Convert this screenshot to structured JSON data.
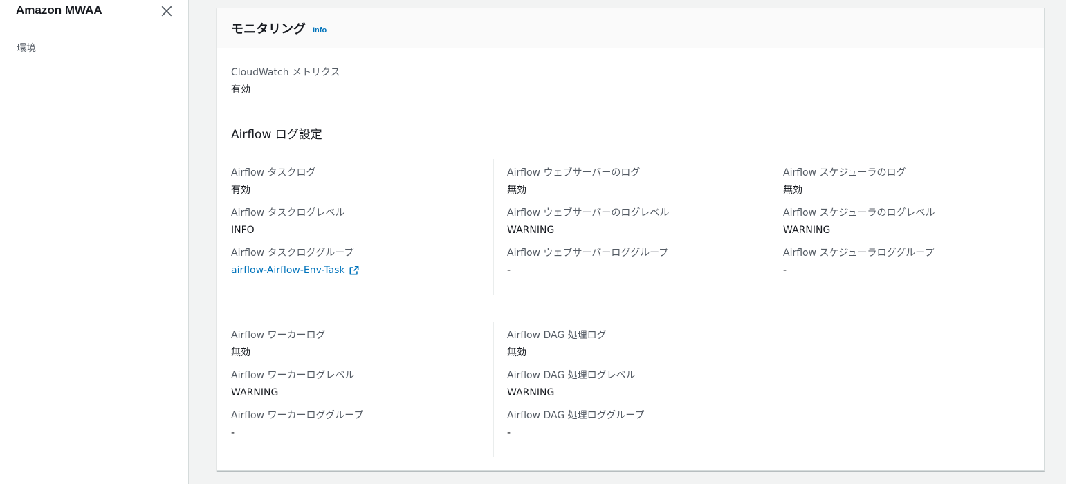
{
  "sidebar": {
    "title": "Amazon MWAA",
    "nav_items": [
      {
        "label": "環境"
      }
    ]
  },
  "panel": {
    "title": "モニタリング",
    "info_label": "Info",
    "cloudwatch": {
      "label": "CloudWatch メトリクス",
      "value": "有効"
    },
    "airflow_log_heading": "Airflow ログ設定",
    "groups_row1": [
      {
        "items": [
          {
            "label": "Airflow タスクログ",
            "value": "有効"
          },
          {
            "label": "Airflow タスクログレベル",
            "value": "INFO"
          },
          {
            "label": "Airflow タスクロググループ",
            "value": "airflow-Airflow-Env-Task",
            "is_link": true
          }
        ]
      },
      {
        "items": [
          {
            "label": "Airflow ウェブサーバーのログ",
            "value": "無効"
          },
          {
            "label": "Airflow ウェブサーバーのログレベル",
            "value": "WARNING"
          },
          {
            "label": "Airflow ウェブサーバーロググループ",
            "value": "-"
          }
        ]
      },
      {
        "items": [
          {
            "label": "Airflow スケジューラのログ",
            "value": "無効"
          },
          {
            "label": "Airflow スケジューラのログレベル",
            "value": "WARNING"
          },
          {
            "label": "Airflow スケジューラロググループ",
            "value": "-"
          }
        ]
      }
    ],
    "groups_row2": [
      {
        "items": [
          {
            "label": "Airflow ワーカーログ",
            "value": "無効"
          },
          {
            "label": "Airflow ワーカーログレベル",
            "value": "WARNING"
          },
          {
            "label": "Airflow ワーカーロググループ",
            "value": "-"
          }
        ]
      },
      {
        "items": [
          {
            "label": "Airflow DAG 処理ログ",
            "value": "無効"
          },
          {
            "label": "Airflow DAG 処理ログレベル",
            "value": "WARNING"
          },
          {
            "label": "Airflow DAG 処理ロググループ",
            "value": "-"
          }
        ]
      }
    ]
  },
  "colors": {
    "link": "#0073bb",
    "label": "#545b64",
    "text": "#16191f",
    "background": "#f2f3f3"
  }
}
